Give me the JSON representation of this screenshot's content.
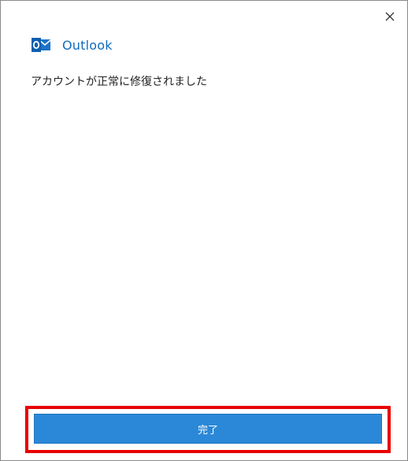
{
  "dialog": {
    "app_name": "Outlook",
    "message": "アカウントが正常に修復されました",
    "done_label": "完了",
    "close_icon": "close-icon",
    "app_icon": "outlook-logo-icon"
  },
  "colors": {
    "brand": "#0f6cbd",
    "button": "#2b88d8",
    "highlight": "#e80000"
  }
}
